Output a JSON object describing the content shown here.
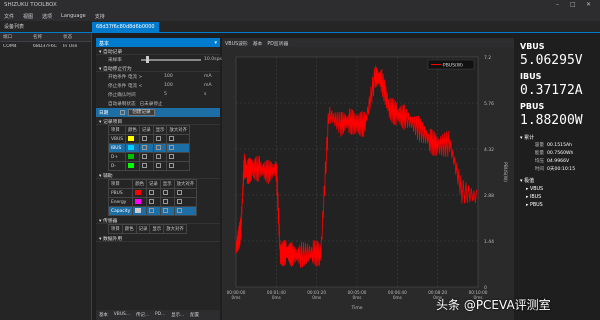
{
  "app": {
    "title": "SHIZUKU TOOLBOX",
    "menu": [
      "文件",
      "视图",
      "选项",
      "Language",
      "支持"
    ],
    "device_tab": "设备列表",
    "file_tab": "68d37f6c80d8d6b0000"
  },
  "device_list": {
    "headers": [
      "端口",
      "名称",
      "状态"
    ],
    "rows": [
      {
        "port": "COM4",
        "name": "68D37F6C",
        "status": "In Use"
      }
    ]
  },
  "settings": {
    "header": "基本",
    "sections": {
      "auto_record": "自动记录",
      "auto_stop": "自动停止行为",
      "record_items": "记录项目",
      "aux": "辅助",
      "sensor": "传感器",
      "data_export": "数据外用"
    },
    "sample_rate_label": "采样率",
    "sample_rate_value": "10.0sps",
    "start_cond_label": "开始条件 电流 >",
    "start_cond_value": "100",
    "stop_cond_label": "停止条件 电流 <",
    "stop_cond_value": "100",
    "stop_confirm_label": "停止确认时间",
    "stop_confirm_value": "5",
    "auto_state_label": "自动录制状态",
    "auto_state_value": "已未录停止",
    "unit_ma": "mA",
    "unit_s": "s",
    "log_label": "日期",
    "log_button": "创建记录",
    "record_headers": [
      "项目",
      "颜色",
      "记录",
      "显示",
      "放大对齐"
    ],
    "record_rows": [
      {
        "name": "VBUS",
        "color": "#ffff00",
        "selected": false
      },
      {
        "name": "IBUS",
        "color": "#00cfff",
        "selected": true
      },
      {
        "name": "D+",
        "color": "#00c000",
        "selected": false
      },
      {
        "name": "D-",
        "color": "#00ff00",
        "selected": false
      }
    ],
    "aux_headers": [
      "项目",
      "颜色",
      "记录",
      "显示",
      "放大对齐"
    ],
    "aux_rows": [
      {
        "name": "PBUS",
        "color": "#ff0000",
        "selected": false
      },
      {
        "name": "Energy",
        "color": "#ff00ff",
        "selected": false
      },
      {
        "name": "Capacity",
        "color": "#cccccc",
        "selected": true
      }
    ],
    "sensor_headers": [
      "项目",
      "颜色",
      "记录",
      "显示",
      "放大对齐"
    ]
  },
  "chart_header": {
    "title": "VBUS波形",
    "tabs": [
      "基本",
      "PD监听器"
    ]
  },
  "chart_data": {
    "type": "line",
    "legend": [
      "PBUS(W)"
    ],
    "xlabel": "Time",
    "x_ticks": [
      "00:00:00\n0ms",
      "00:01:40\n0ms",
      "00:03:20\n0ms",
      "00:05:00\n0ms",
      "00:06:40\n0ms",
      "00:08:20\n0ms",
      "00:10:00\n0ms"
    ],
    "y_right_ticks": [
      "7.2",
      "5.76",
      "4.32",
      "2.88",
      "1.44",
      "0"
    ],
    "y_right_label": "PBUS(W)",
    "ylim": [
      0,
      7.2
    ],
    "series": [
      {
        "name": "PBUS(W)",
        "color": "#ff0000",
        "x": [
          0,
          12,
          20,
          28,
          40,
          60,
          80,
          100,
          110,
          125,
          140,
          160,
          190,
          210,
          230,
          260,
          280,
          300,
          320,
          345,
          360,
          380,
          400,
          420,
          450,
          480,
          500,
          530,
          560,
          600
        ],
        "values": [
          1.2,
          1.8,
          3.8,
          3.6,
          3.7,
          3.7,
          3.6,
          3.7,
          1.0,
          1.1,
          1.0,
          1.0,
          1.1,
          1.0,
          5.4,
          5.1,
          5.2,
          5.1,
          5.1,
          6.6,
          6.5,
          5.6,
          5.4,
          5.3,
          5.0,
          4.6,
          4.4,
          4.5,
          3.0,
          2.8
        ]
      }
    ]
  },
  "readouts": {
    "vbus_label": "VBUS",
    "vbus_value": "5.06295V",
    "ibus_label": "IBUS",
    "ibus_value": "0.37172A",
    "pbus_label": "PBUS",
    "pbus_value": "1.88200W",
    "acc_label": "累计",
    "acc_rows": [
      {
        "label": "容量",
        "value": "00.1515Ah"
      },
      {
        "label": "能量",
        "value": "00.7560Wh"
      },
      {
        "label": "均压",
        "value": "04.9966V"
      },
      {
        "label": "时间",
        "value": "0天00:10:15"
      }
    ],
    "minmax_label": "极值",
    "minmax_items": [
      "VBUS",
      "IBUS",
      "PBUS"
    ]
  },
  "bottom_tabs": [
    "基本",
    "VBUS...",
    "传记...",
    "PD...",
    "显示...",
    "配置"
  ],
  "watermark": "头条 @PCEVA评测室"
}
